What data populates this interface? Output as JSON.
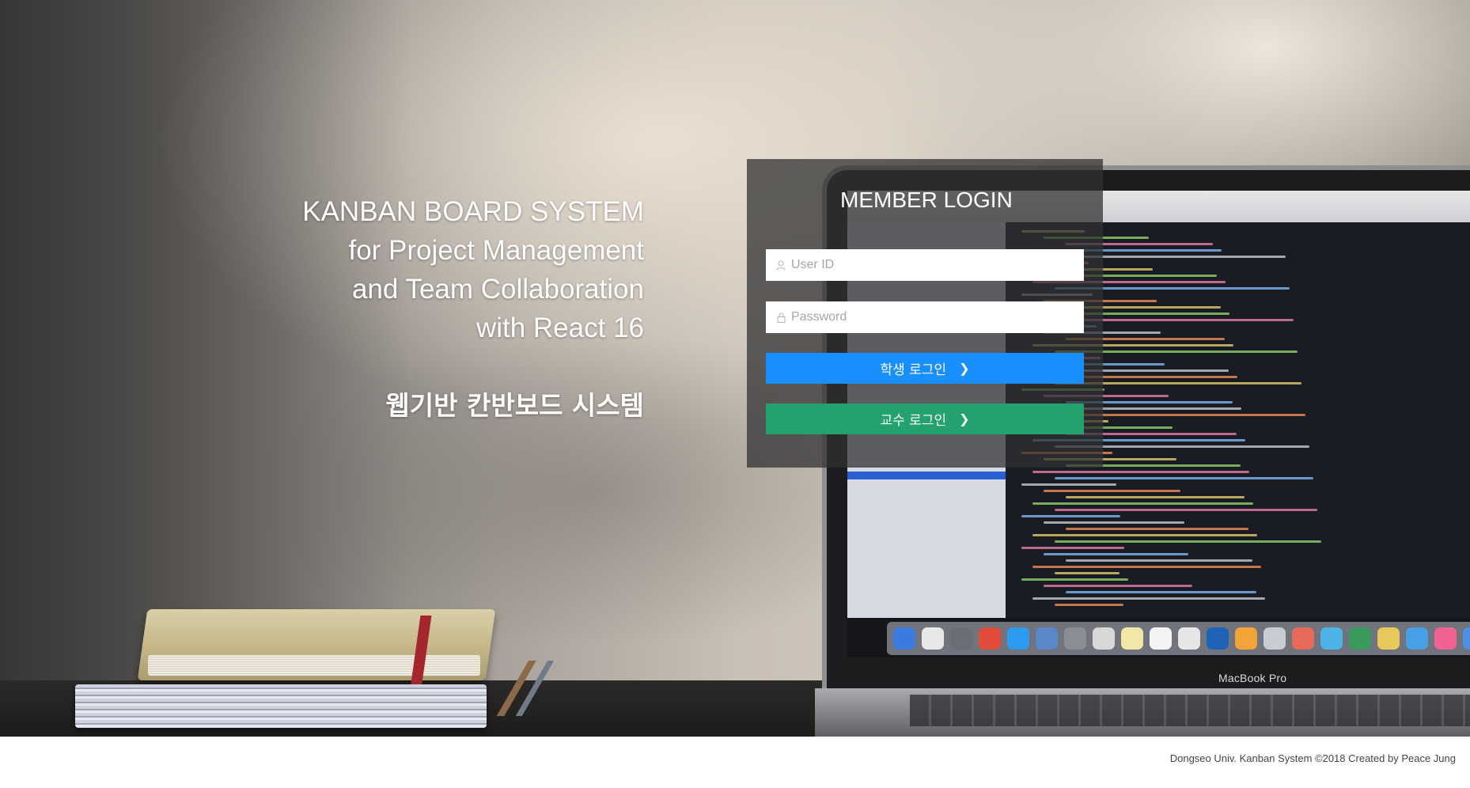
{
  "hero": {
    "title_lines": [
      "KANBAN BOARD SYSTEM",
      "for Project Management",
      "and Team Collaboration",
      "with React 16"
    ],
    "subtitle_ko": "웹기반 칸반보드 시스템",
    "laptop_brand": "MacBook Pro"
  },
  "login": {
    "title": "MEMBER LOGIN",
    "userid_placeholder": "User ID",
    "password_placeholder": "Password",
    "student_button_label": "학생 로그인",
    "professor_button_label": "교수 로그인",
    "chevron_icon": "chevron-right-icon"
  },
  "footer": {
    "text": "Dongseo Univ. Kanban System ©2018 Created by Peace Jung"
  },
  "colors": {
    "student_button": "#1890ff",
    "professor_button": "#23a26e",
    "panel_overlay": "rgba(48,48,50,0.74)"
  }
}
